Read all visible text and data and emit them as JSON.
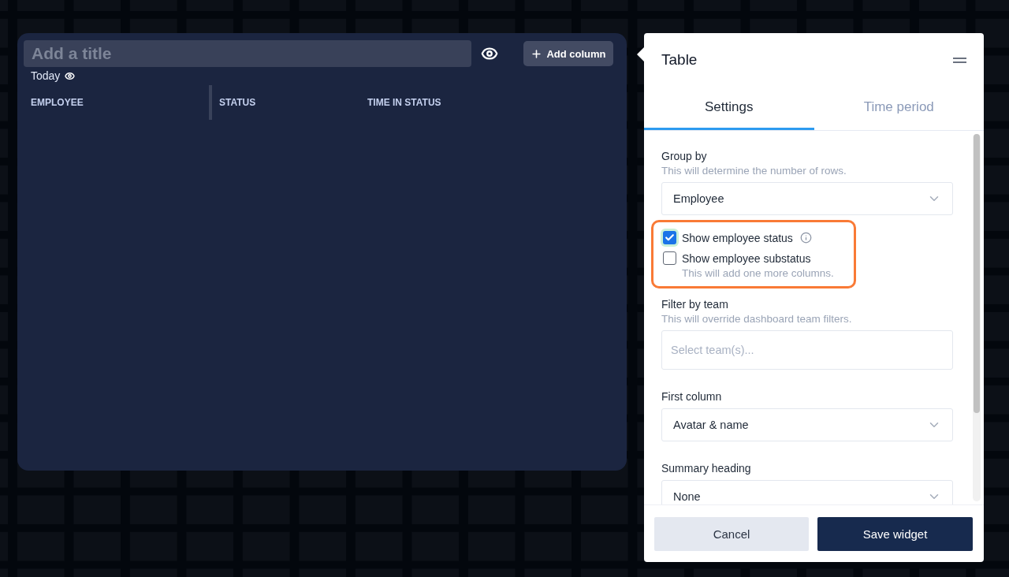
{
  "widget": {
    "title": {
      "placeholder": "Add a title"
    },
    "period": "Today",
    "add_column": "Add column",
    "columns": [
      "EMPLOYEE",
      "STATUS",
      "TIME IN STATUS"
    ]
  },
  "panel": {
    "title": "Table",
    "tabs": [
      {
        "label": "Settings",
        "selected": true
      },
      {
        "label": "Time period",
        "selected": false
      }
    ],
    "sections": [
      {
        "kind": "select",
        "label": "Group by",
        "hint": "This will determine the number of rows.",
        "value": "Employee"
      },
      {
        "kind": "checkboxes",
        "highlighted": true,
        "items": [
          {
            "label": "Show employee status",
            "checked": true,
            "info": true
          },
          {
            "label": "Show employee substatus",
            "checked": false,
            "info": false,
            "hint": "This will add one more columns."
          }
        ]
      },
      {
        "kind": "input",
        "label": "Filter by team",
        "hint": "This will override dashboard team filters.",
        "placeholder": "Select team(s)..."
      },
      {
        "kind": "select",
        "label": "First column",
        "value": "Avatar & name"
      },
      {
        "kind": "select",
        "label": "Summary heading",
        "value": "None"
      }
    ],
    "buttons": [
      {
        "label": "Cancel",
        "kind": "secondary"
      },
      {
        "label": "Save widget",
        "kind": "primary"
      }
    ]
  }
}
